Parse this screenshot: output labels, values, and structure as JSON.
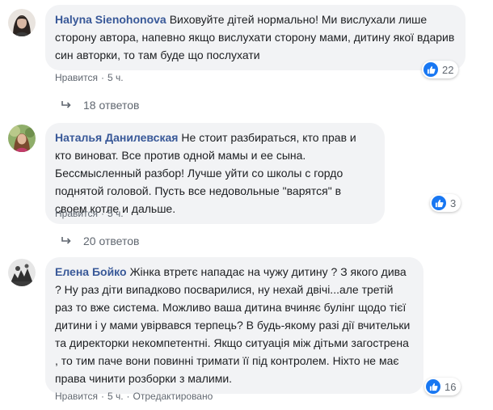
{
  "comments": [
    {
      "author": "Halyna Sienohonova",
      "text": "Виховуйте дітей нормально! Ми вислухали лише сторону автора, напевно якщо вислухати сторону мами, дитину якої вдарив син авторки, то там буде що послухати",
      "like_label": "Нравится",
      "time": "5 ч.",
      "reactions": "22",
      "replies": "18 ответов"
    },
    {
      "author": "Наталья Данилевская",
      "text": "Не стоит разбираться, кто прав и кто виноват. Все против одной мамы и ее сына. Бессмысленный разбор! Лучше уйти со школы с гордо поднятой головой. Пусть все недовольные \"варятся\" в своем котле и дальше.",
      "like_label": "Нравится",
      "time": "5 ч.",
      "reactions": "3",
      "replies": "20 ответов"
    },
    {
      "author": "Елена Бойко",
      "text": "Жінка втретє нападає на чужу дитину ? З якого дива ? Ну раз діти випадково посварилися, ну нехай двічі...але третій раз то вже система. Можливо ваша дитина вчиняє булінг щодо тієї дитини і у мами увірвався терпець? В будь-якому разі дії вчительки та директорки некомпетентні. Якщо ситуація між дітьми загострена , то тим паче вони повинні тримати її під контролем. Ніхто не має права чинити розборки з малими.",
      "like_label": "Нравится",
      "time": "5 ч.",
      "edited": "Отредактировано",
      "reactions": "16"
    }
  ],
  "colors": {
    "author": "#385898",
    "bubble": "#f2f3f5",
    "meta": "#606770",
    "like_blue": "#1877f2"
  },
  "icons": [
    "avatar",
    "like-thumb-icon",
    "reply-arrow-icon"
  ]
}
